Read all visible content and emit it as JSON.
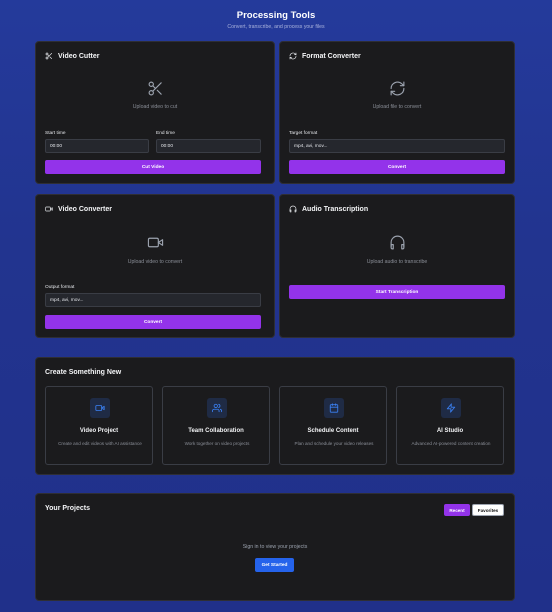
{
  "header": {
    "title": "Processing Tools",
    "subtitle": "Convert, transcribe, and process your files"
  },
  "video_cutter": {
    "title": "Video Cutter",
    "icon": "scissors-icon",
    "upload_text": "Upload video to cut",
    "start_label": "Start time",
    "start_value": "00:00",
    "end_label": "End time",
    "end_value": "00:00",
    "button": "Cut Video"
  },
  "format_converter": {
    "title": "Format Converter",
    "icon": "refresh-icon",
    "upload_text": "Upload file to convert",
    "target_label": "Target format",
    "target_placeholder": "mp4, avi, mov...",
    "button": "Convert"
  },
  "video_converter": {
    "title": "Video Converter",
    "icon": "video-icon",
    "upload_text": "Upload video to convert",
    "output_label": "Output format",
    "output_placeholder": "mp4, avi, mov...",
    "button": "Convert"
  },
  "audio_transcription": {
    "title": "Audio Transcription",
    "icon": "headphones-icon",
    "upload_text": "Upload audio to transcribe",
    "button": "Start Transcription"
  },
  "create": {
    "title": "Create Something New",
    "items": [
      {
        "title": "Video Project",
        "desc": "Create and edit videos with AI assistance",
        "icon": "video-icon"
      },
      {
        "title": "Team Collaboration",
        "desc": "Work together on video projects",
        "icon": "users-icon"
      },
      {
        "title": "Schedule Content",
        "desc": "Plan and schedule your video releases",
        "icon": "calendar-icon"
      },
      {
        "title": "AI Studio",
        "desc": "Advanced AI-powered content creation",
        "icon": "lightning-icon"
      }
    ]
  },
  "projects": {
    "title": "Your Projects",
    "tabs": [
      "Recent",
      "Favorites"
    ],
    "empty_text": "Sign in to view your projects",
    "button": "Get Started"
  },
  "colors": {
    "accent": "#9333ea",
    "primary_blue": "#2563eb",
    "card_bg": "#1b1b1d",
    "page_bg": "#22348f"
  }
}
